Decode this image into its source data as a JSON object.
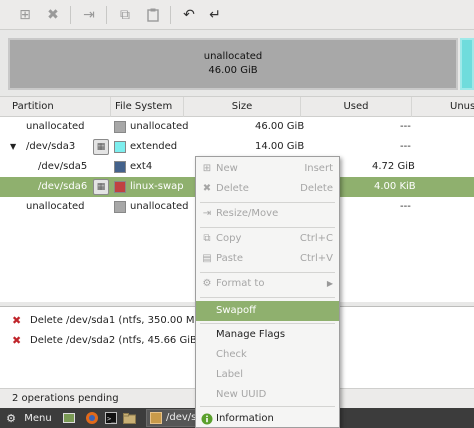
{
  "toolbar": {
    "buttons": [
      {
        "name": "new-icon",
        "glyph": "⊞"
      },
      {
        "name": "delete-icon",
        "glyph": "✖"
      },
      {
        "name": "resize-icon",
        "glyph": "⇥"
      },
      {
        "name": "copy-icon",
        "glyph": "⧉"
      },
      {
        "name": "paste-icon",
        "glyph": "📋"
      },
      {
        "name": "undo-icon",
        "glyph": "↶"
      },
      {
        "name": "apply-icon",
        "glyph": "↵"
      }
    ]
  },
  "map": {
    "label": "unallocated",
    "size": "46.00 GiB"
  },
  "table": {
    "headers": {
      "partition": "Partition",
      "filesystem": "File System",
      "size": "Size",
      "used": "Used",
      "unused": "Unus"
    },
    "rows": [
      {
        "partition": "unallocated",
        "fs": "unallocated",
        "fs_color": "#a8a8a8",
        "size": "46.00 GiB",
        "used": "---"
      },
      {
        "partition": "/dev/sda3",
        "fs": "extended",
        "fs_color": "#7deeee",
        "size": "14.00 GiB",
        "used": "---"
      },
      {
        "partition": "/dev/sda5",
        "fs": "ext4",
        "fs_color": "#44628b",
        "size": "",
        "used": "4.72 GiB"
      },
      {
        "partition": "/dev/sda6",
        "fs": "linux-swap",
        "fs_color": "#c04141",
        "size": "",
        "used": "4.00 KiB"
      },
      {
        "partition": "unallocated",
        "fs": "unallocated",
        "fs_color": "#a8a8a8",
        "size": "",
        "used": "---"
      }
    ]
  },
  "operations": [
    "Delete /dev/sda1 (ntfs, 350.00 MiB) fro",
    "Delete /dev/sda2 (ntfs, 45.66 GiB) fro"
  ],
  "status": "2 operations pending",
  "taskbar": {
    "menu_label": "Menu",
    "window_label": "/dev/sc"
  },
  "context_menu": {
    "new": "New",
    "new_shortcut": "Insert",
    "delete": "Delete",
    "delete_shortcut": "Delete",
    "resize": "Resize/Move",
    "copy": "Copy",
    "copy_shortcut": "Ctrl+C",
    "paste": "Paste",
    "paste_shortcut": "Ctrl+V",
    "format": "Format to",
    "swapoff": "Swapoff",
    "manage_flags": "Manage Flags",
    "check": "Check",
    "label": "Label",
    "new_uuid": "New UUID",
    "information": "Information"
  },
  "colors": {
    "selection": "#8fb06e",
    "unallocated": "#a8a8a8",
    "extended": "#7deeee"
  }
}
